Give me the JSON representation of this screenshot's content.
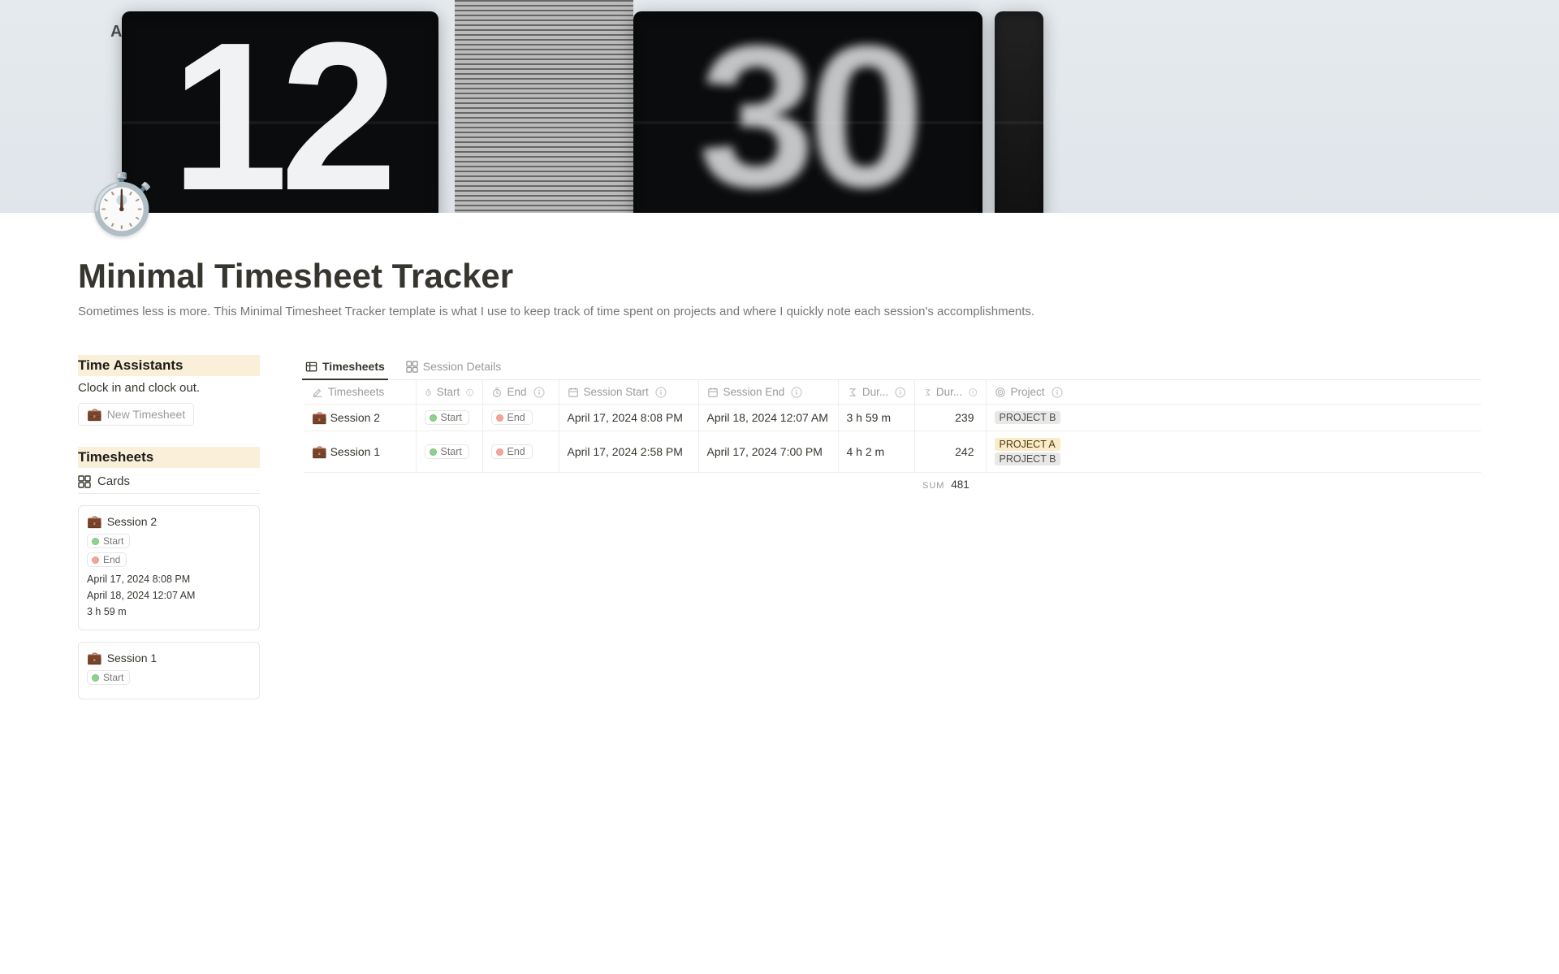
{
  "cover": {
    "icon": "⏱️",
    "am": "AM",
    "digit1": "12",
    "digit2": "30"
  },
  "title": "Minimal Timesheet Tracker",
  "description": "Sometimes less is more. This Minimal Timesheet Tracker template is what I use to keep track of time spent on projects and where I quickly note each session's accomplishments.",
  "left": {
    "assistants_heading": "Time Assistants",
    "assistants_sub": "Clock in and clock out.",
    "new_btn_icon": "💼",
    "new_btn_label": "New Timesheet",
    "timesheets_heading": "Timesheets",
    "cards_view_label": "Cards"
  },
  "pills": {
    "start": "Start",
    "end": "End"
  },
  "cards": [
    {
      "icon": "💼",
      "title": "Session 2",
      "start": "April 17, 2024 8:08 PM",
      "end": "April 18, 2024 12:07 AM",
      "duration": "3 h 59 m"
    },
    {
      "icon": "💼",
      "title": "Session 1",
      "start": "",
      "end": "",
      "duration": ""
    }
  ],
  "tabs": {
    "main": "Timesheets",
    "secondary": "Session Details"
  },
  "columns": {
    "timesheets": "Timesheets",
    "start": "Start",
    "end": "End",
    "session_start": "Session Start",
    "session_end": "Session End",
    "dur1": "Dur...",
    "dur2": "Dur...",
    "project": "Project"
  },
  "rows": [
    {
      "icon": "💼",
      "name": "Session 2",
      "sstart": "April 17, 2024 8:08 PM",
      "send": "April 18, 2024 12:07 AM",
      "dur_text": "3 h 59 m",
      "dur_num": "239",
      "projects": [
        {
          "label": "PROJECT B",
          "cls": "pb"
        }
      ]
    },
    {
      "icon": "💼",
      "name": "Session 1",
      "sstart": "April 17, 2024 2:58 PM",
      "send": "April 17, 2024 7:00 PM",
      "dur_text": "4 h 2 m",
      "dur_num": "242",
      "projects": [
        {
          "label": "PROJECT A",
          "cls": "pa"
        },
        {
          "label": "PROJECT B",
          "cls": "pb"
        }
      ]
    }
  ],
  "sum": {
    "label": "sum",
    "value": "481"
  }
}
